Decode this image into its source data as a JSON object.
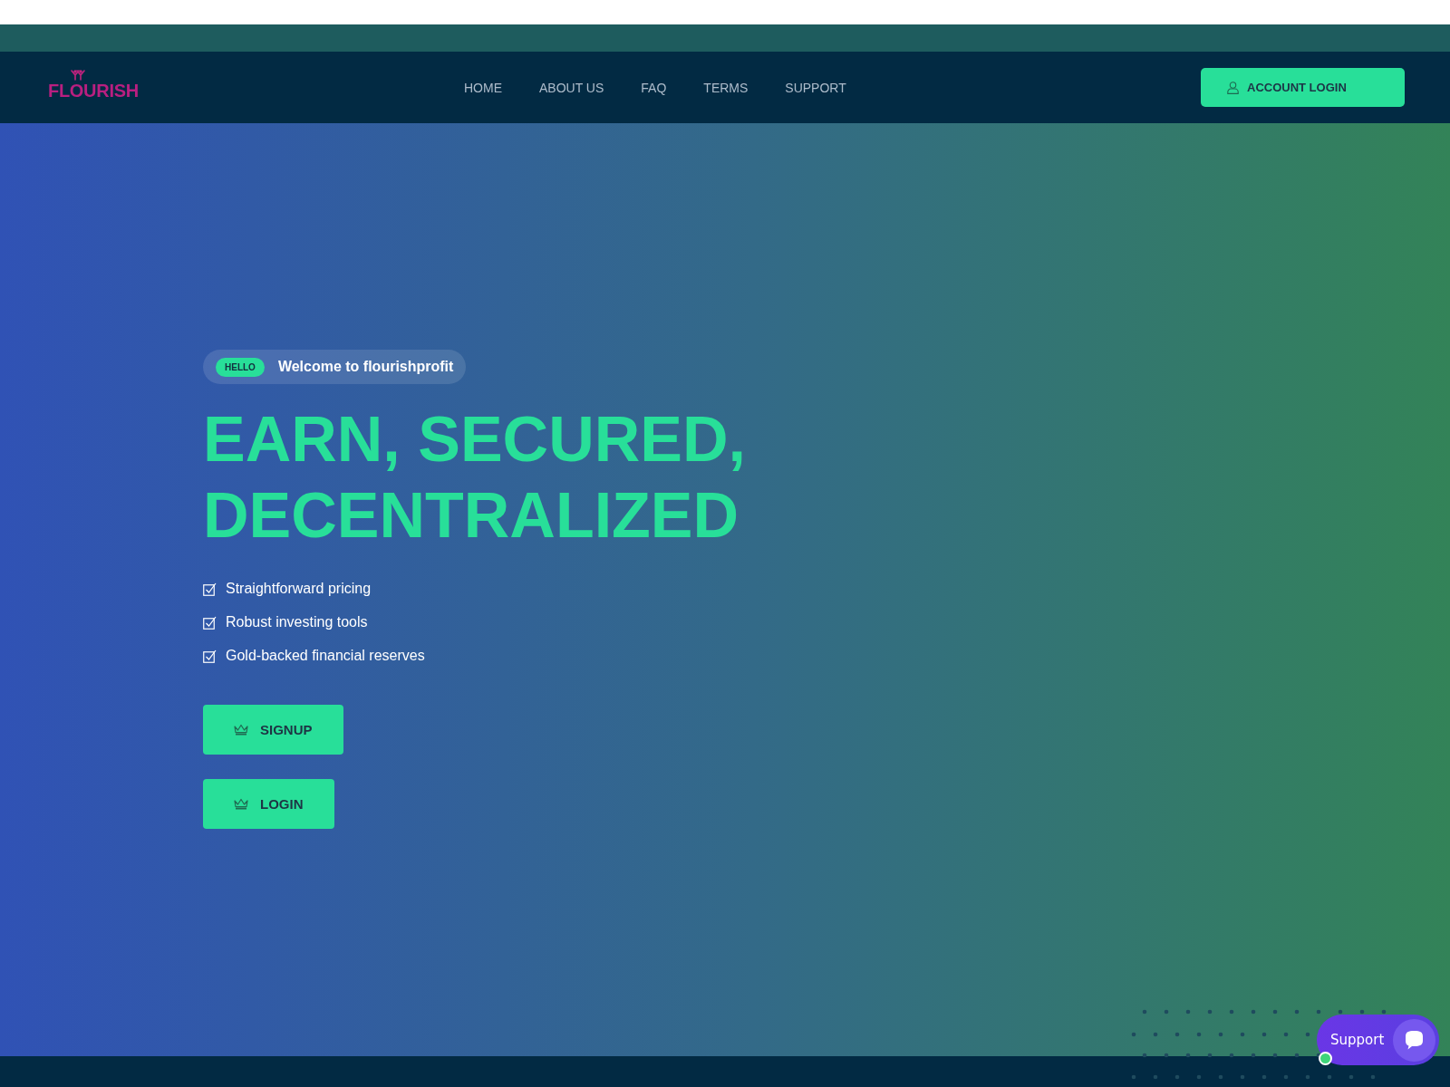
{
  "logo": {
    "text": "FLOURISH"
  },
  "nav": {
    "items": [
      {
        "label": "HOME"
      },
      {
        "label": "ABOUT US"
      },
      {
        "label": "FAQ"
      },
      {
        "label": "TERMS"
      },
      {
        "label": "SUPPORT"
      }
    ]
  },
  "account_button": {
    "label": "ACCOUNT LOGIN"
  },
  "hero": {
    "badge": "HELLO",
    "welcome": "Welcome to flourishprofit",
    "headline": [
      "EARN, SECURED,",
      "DECENTRALIZED"
    ],
    "features": [
      {
        "text": "Straightforward pricing",
        "checked": true
      },
      {
        "text": "Robust investing tools",
        "checked": true
      },
      {
        "text": "Gold-backed financial reserves",
        "checked": true
      }
    ],
    "buttons": [
      {
        "label": "SIGNUP"
      },
      {
        "label": "LOGIN"
      }
    ]
  },
  "support_widget": {
    "label": "Support",
    "online": true
  }
}
